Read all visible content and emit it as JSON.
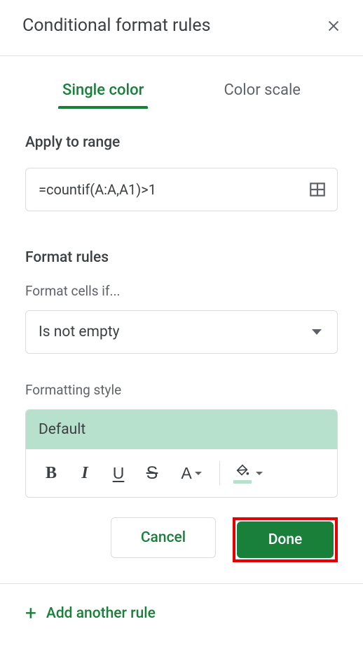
{
  "header": {
    "title": "Conditional format rules"
  },
  "tabs": {
    "single_color": "Single color",
    "color_scale": "Color scale"
  },
  "range": {
    "label": "Apply to range",
    "value": "=countif(A:A,A1)>1"
  },
  "rules": {
    "label": "Format rules",
    "condition_label": "Format cells if...",
    "condition_value": "Is not empty",
    "style_label": "Formatting style",
    "style_preview": "Default"
  },
  "toolbar": {
    "bold": "B",
    "italic": "I",
    "underline": "U",
    "strike": "S",
    "textcolor": "A"
  },
  "actions": {
    "cancel": "Cancel",
    "done": "Done"
  },
  "footer": {
    "add_rule": "Add another rule"
  },
  "colors": {
    "brand_green": "#188038",
    "preview_bg": "#b7e1cd",
    "highlight_box": "#e60000"
  }
}
